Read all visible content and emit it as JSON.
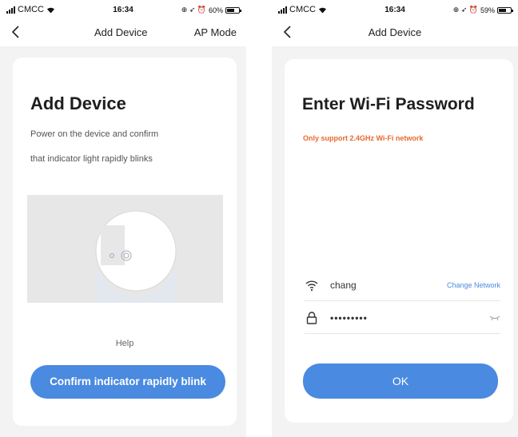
{
  "left": {
    "status": {
      "carrier": "CMCC",
      "time": "16:34",
      "battery": "60%",
      "battery_level": 0.6
    },
    "nav": {
      "title": "Add Device",
      "action": "AP Mode"
    },
    "card": {
      "headline": "Add Device",
      "desc_line1": "Power on the device and confirm",
      "desc_line2": "that indicator light rapidly blinks",
      "help": "Help",
      "button": "Confirm indicator rapidly blink"
    }
  },
  "right": {
    "status": {
      "carrier": "CMCC",
      "time": "16:34",
      "battery": "59%",
      "battery_level": 0.59
    },
    "nav": {
      "title": "Add Device"
    },
    "card": {
      "headline": "Enter Wi-Fi Password",
      "warning": "Only support 2.4GHz Wi-Fi network",
      "ssid": "chang",
      "change_network": "Change Network",
      "password": "•••••••••",
      "button": "OK"
    }
  },
  "colors": {
    "accent": "#4a8ae0",
    "warning": "#e8692c",
    "background": "#f3f3f3"
  },
  "icons": [
    "back-chevron-icon",
    "wifi-icon",
    "lock-icon",
    "eye-closed-icon",
    "signal-icon",
    "battery-icon"
  ]
}
